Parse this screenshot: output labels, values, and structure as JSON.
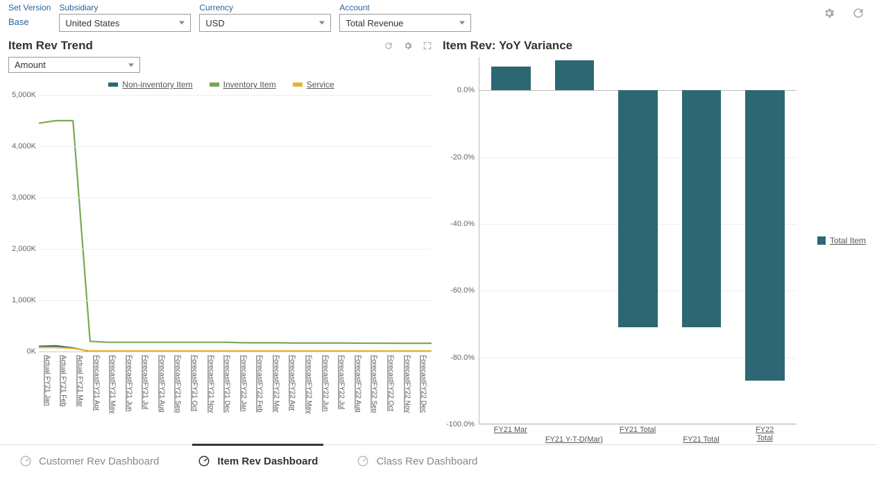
{
  "filters": {
    "set_version_label": "Set Version",
    "base_value": "Base",
    "subsidiary_label": "Subsidiary",
    "subsidiary_value": "United States",
    "currency_label": "Currency",
    "currency_value": "USD",
    "account_label": "Account",
    "account_value": "Total Revenue"
  },
  "left_panel": {
    "title": "Item Rev Trend",
    "amount_value": "Amount",
    "legend": {
      "non_inventory": "Non-inventory Item",
      "inventory": "Inventory Item",
      "service": "Service"
    }
  },
  "right_panel": {
    "title": "Item Rev: YoY Variance",
    "legend_label": "Total Item"
  },
  "tabs": {
    "customer": "Customer Rev Dashboard",
    "item": "Item Rev Dashboard",
    "class": "Class Rev Dashboard"
  },
  "chart_data": [
    {
      "type": "line",
      "title": "Item Rev Trend",
      "ylabel": "",
      "ylim": [
        0,
        5000
      ],
      "y_ticks": [
        "0K",
        "1,000K",
        "2,000K",
        "3,000K",
        "4,000K",
        "5,000K"
      ],
      "categories": [
        "Actual FY21 Jan",
        "Actual FY21 Feb",
        "Actual FY21 Mar",
        "ForecastFY21 Apr",
        "ForecastFY21 May",
        "ForecastFY21 Jun",
        "ForecastFY21 Jul",
        "ForecastFY21 Aug",
        "ForecastFY21 Sep",
        "ForecastFY21 Oct",
        "ForecastFY21 Nov",
        "ForecastFY21 Dec",
        "ForecastFY22 Jan",
        "ForecastFY22 Feb",
        "ForecastFY22 Mar",
        "ForecastFY22 Apr",
        "ForecastFY22 May",
        "ForecastFY22 Jun",
        "ForecastFY22 Jul",
        "ForecastFY22 Aug",
        "ForecastFY22 Sep",
        "ForecastFY22 Oct",
        "ForecastFY22 Nov",
        "ForecastFY22 Dec"
      ],
      "series": [
        {
          "name": "Non-inventory Item",
          "color": "#2d6773",
          "values": [
            100,
            110,
            70,
            0,
            0,
            0,
            0,
            0,
            0,
            0,
            0,
            0,
            0,
            0,
            0,
            0,
            0,
            0,
            0,
            0,
            0,
            0,
            0,
            0
          ]
        },
        {
          "name": "Inventory Item",
          "color": "#7aa953",
          "values": [
            4450,
            4500,
            4500,
            200,
            180,
            180,
            180,
            180,
            180,
            180,
            180,
            180,
            170,
            170,
            170,
            165,
            165,
            165,
            165,
            163,
            162,
            161,
            160,
            160
          ]
        },
        {
          "name": "Service",
          "color": "#e6b533",
          "values": [
            80,
            80,
            60,
            10,
            10,
            10,
            10,
            10,
            10,
            10,
            10,
            10,
            10,
            10,
            10,
            10,
            10,
            10,
            10,
            10,
            10,
            10,
            10,
            10
          ]
        }
      ]
    },
    {
      "type": "bar",
      "title": "Item Rev: YoY Variance",
      "ylabel": "",
      "ylim": [
        -100,
        10
      ],
      "y_ticks": [
        "0.0%",
        "-20.0%",
        "-40.0%",
        "-60.0%",
        "-80.0%",
        "-100.0%"
      ],
      "categories": [
        "FY21 Mar",
        "FY21 Y-T-D(Mar)",
        "FY21 Total",
        "FY21 Total",
        "FY22 Total"
      ],
      "series": [
        {
          "name": "Total Item",
          "color": "#2d6773",
          "values": [
            7,
            9,
            -71,
            -71,
            -87
          ]
        }
      ]
    }
  ]
}
